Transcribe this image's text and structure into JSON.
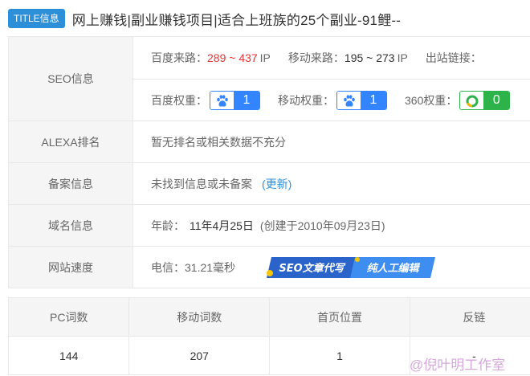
{
  "header": {
    "badge": "TITLE信息",
    "title": "网上赚钱|副业赚钱项目|适合上班族的25个副业-91鲤--"
  },
  "seo": {
    "label": "SEO信息",
    "baidu_traffic_label": "百度来路：",
    "baidu_traffic_value": "289 ~ 437",
    "baidu_traffic_unit": "IP",
    "mobile_traffic_label": "移动来路：",
    "mobile_traffic_value": "195 ~ 273",
    "mobile_traffic_unit": "IP",
    "outbound_label": "出站链接：",
    "baidu_weight_label": "百度权重：",
    "baidu_weight_value": "1",
    "mobile_weight_label": "移动权重：",
    "mobile_weight_value": "1",
    "so360_weight_label": "360权重：",
    "so360_weight_value": "0"
  },
  "alexa": {
    "label": "ALEXA排名",
    "value": "暂无排名或相关数据不充分"
  },
  "beian": {
    "label": "备案信息",
    "value": "未找到信息或未备案",
    "update_link": "(更新)"
  },
  "domain": {
    "label": "域名信息",
    "age_label": "年龄：",
    "age_value": "11年4月25日",
    "created": "(创建于2010年09月23日)"
  },
  "speed": {
    "label": "网站速度",
    "value": "电信：31.21毫秒"
  },
  "banner": {
    "part1": "SEO文章代写",
    "part2": "纯人工编辑"
  },
  "stats": {
    "headers": [
      "PC词数",
      "移动词数",
      "首页位置",
      "反链"
    ],
    "values": [
      "144",
      "207",
      "1",
      "-"
    ]
  },
  "watermark": "@倪叶明工作室",
  "colors": {
    "accent_blue": "#2d8fd8",
    "baidu_blue": "#3385ff",
    "so360_green": "#2eb24a",
    "traffic_red": "#e53333"
  }
}
